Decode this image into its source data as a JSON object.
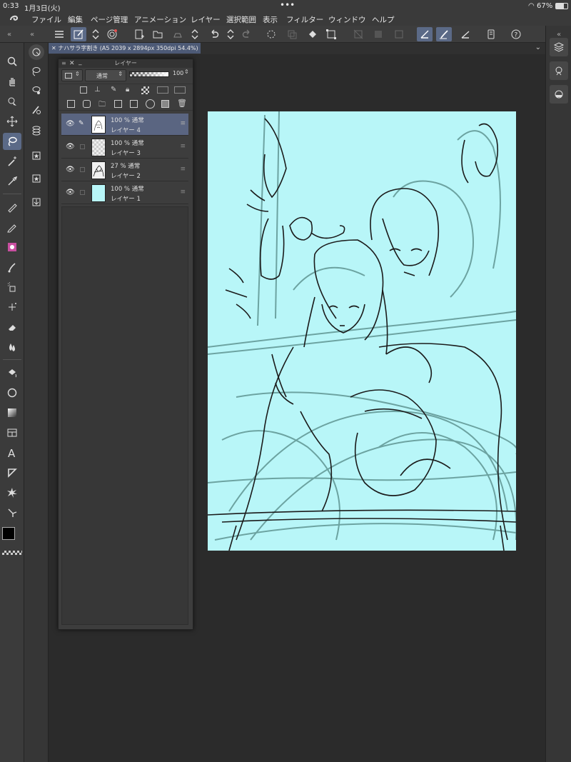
{
  "status": {
    "time": "0:33",
    "date": "1月3日(火)",
    "dots": "•••",
    "battery": "67%"
  },
  "menu": [
    "ファイル",
    "編集",
    "ページ管理",
    "アニメーション",
    "レイヤー",
    "選択範囲",
    "表示",
    "フィルター",
    "ウィンドウ",
    "ヘルプ"
  ],
  "document_tab": {
    "title": "ナハサラ字割き (A5 2039 x 2894px 350dpi 54.4%)"
  },
  "layer_panel": {
    "title": "レイヤー",
    "blend_mode": "通常",
    "opacity": "100",
    "opacity_fraction": 1.0,
    "layers": [
      {
        "opacity_blend": "100 % 通常",
        "name": "レイヤー 4",
        "selected": true
      },
      {
        "opacity_blend": "100 % 通常",
        "name": "レイヤー 3",
        "selected": false
      },
      {
        "opacity_blend": "27 % 通常",
        "name": "レイヤー 2",
        "selected": false
      },
      {
        "opacity_blend": "100 % 通常",
        "name": "レイヤー 1",
        "selected": false
      }
    ]
  },
  "colors": {
    "canvas_paper": "#b8f6f8",
    "selection": "#5a6581",
    "main_color": "#000000",
    "sub_color": "#3d4a57"
  }
}
